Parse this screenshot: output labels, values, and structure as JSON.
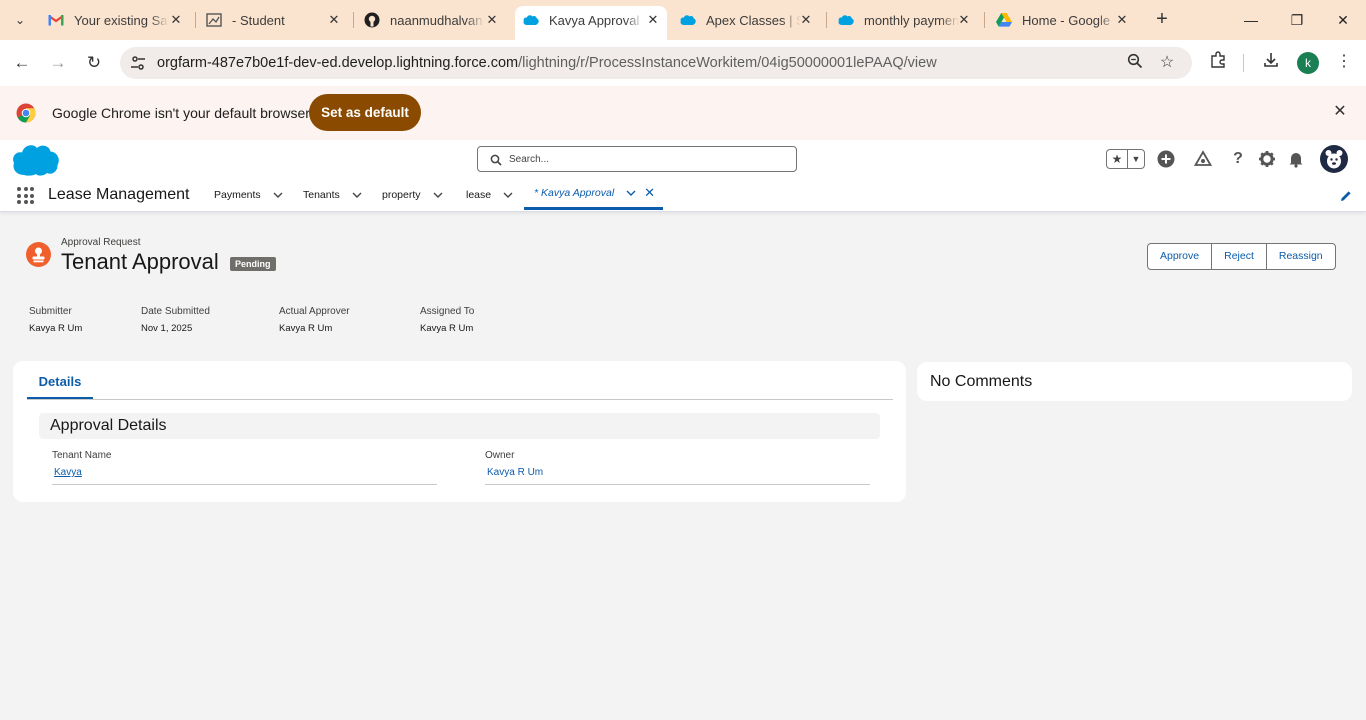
{
  "browser": {
    "tabs": [
      {
        "title": "Your existing Sal",
        "icon": "gmail-icon"
      },
      {
        "title": "- Student",
        "icon": "student-icon"
      },
      {
        "title": "naanmudhalvan",
        "icon": "github-icon"
      },
      {
        "title": "Kavya Approval |",
        "icon": "salesforce-cloud-icon",
        "active": true
      },
      {
        "title": "Apex Classes | Sa",
        "icon": "salesforce-cloud-icon"
      },
      {
        "title": "monthly paymen",
        "icon": "salesforce-cloud-icon"
      },
      {
        "title": "Home - Google",
        "icon": "google-drive-icon"
      }
    ],
    "url_host": "orgfarm-487e7b0e1f-dev-ed.develop.lightning.force.com",
    "url_path": "/lightning/r/ProcessInstanceWorkitem/04ig50000001lePAAQ/view",
    "profile_initial": "k",
    "infobar": {
      "message": "Google Chrome isn't your default browser",
      "button": "Set as default"
    }
  },
  "salesforce": {
    "search_placeholder": "Search...",
    "app_name": "Lease Management",
    "nav_items": [
      "Payments",
      "Tenants",
      "property",
      "lease"
    ],
    "active_tab": "* Kavya Approval"
  },
  "record": {
    "kicker": "Approval Request",
    "title": "Tenant Approval",
    "status": "Pending",
    "actions": [
      "Approve",
      "Reject",
      "Reassign"
    ],
    "fields": [
      {
        "label": "Submitter",
        "value": "Kavya R Um"
      },
      {
        "label": "Date Submitted",
        "value": "Nov 1, 2025"
      },
      {
        "label": "Actual Approver",
        "value": "Kavya R Um"
      },
      {
        "label": "Assigned To",
        "value": "Kavya R Um"
      }
    ],
    "tab_label": "Details",
    "section_title": "Approval Details",
    "detail_fields": [
      {
        "label": "Tenant Name",
        "value": "Kavya"
      },
      {
        "label": "Owner",
        "value": "Kavya R Um"
      }
    ],
    "comments_label": "No Comments"
  },
  "colors": {
    "brand_blue": "#0b5cab",
    "salesforce_cloud": "#00a1e0",
    "approval_icon": "#f0602c",
    "set_default_button": "#8a4a00"
  }
}
